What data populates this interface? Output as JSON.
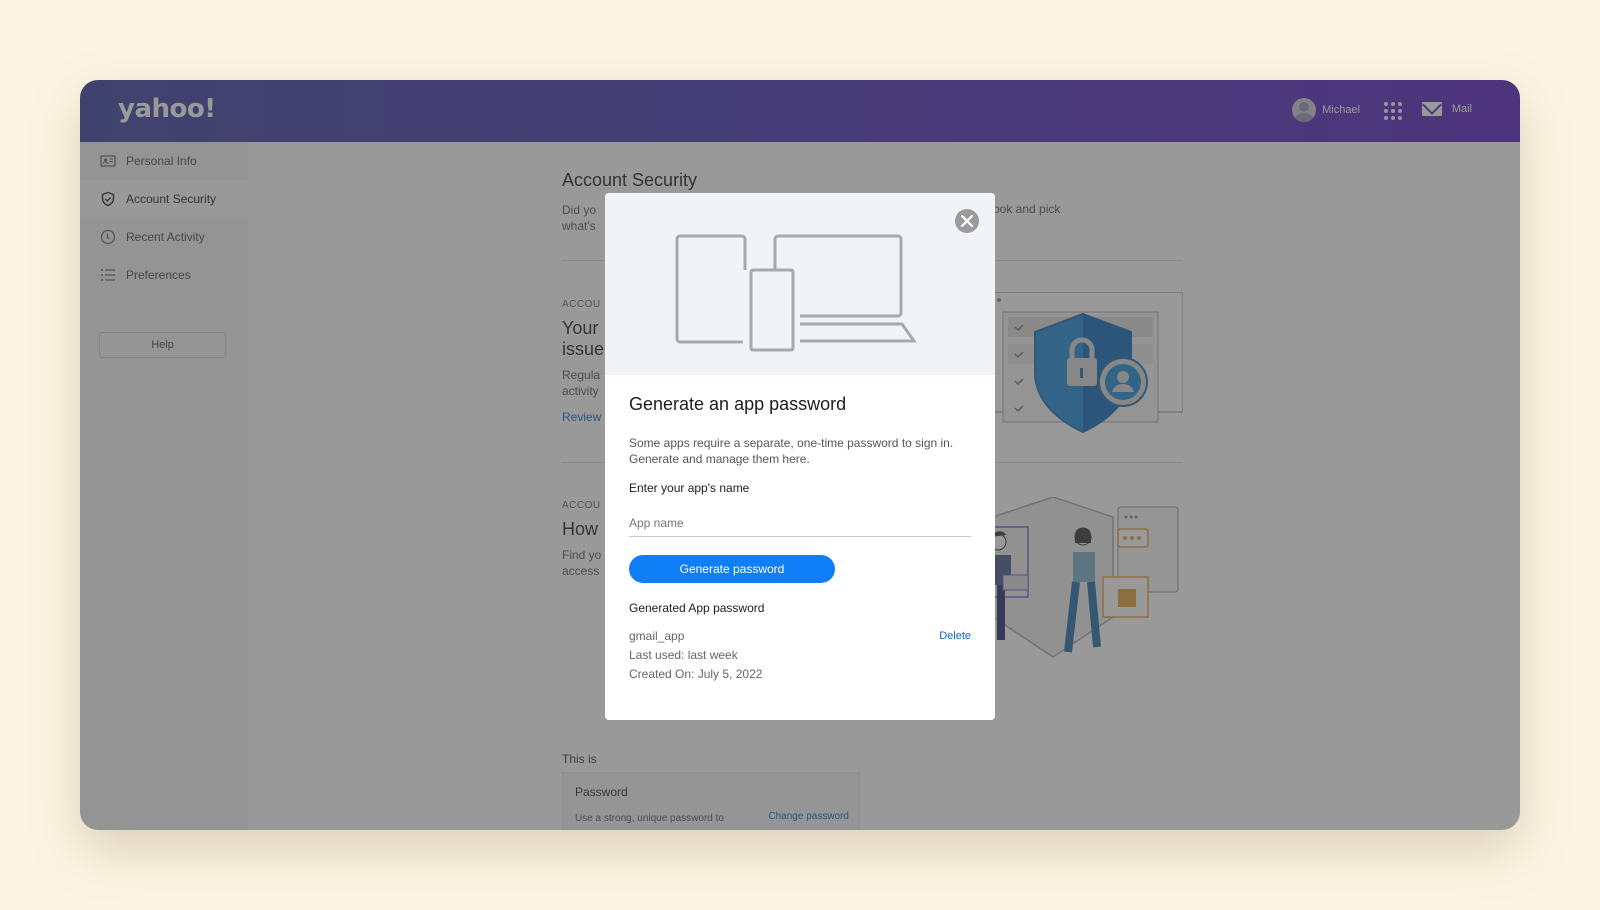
{
  "brand": {
    "logo": "yahoo!"
  },
  "header": {
    "user_name": "Michael",
    "mail_label": "Mail"
  },
  "sidebar": {
    "items": [
      {
        "label": "Personal Info",
        "icon": "id-card-icon",
        "active": false
      },
      {
        "label": "Account Security",
        "icon": "shield-check-icon",
        "active": true
      },
      {
        "label": "Recent Activity",
        "icon": "clock-icon",
        "active": false
      },
      {
        "label": "Preferences",
        "icon": "list-icon",
        "active": false
      }
    ],
    "help_label": "Help"
  },
  "main": {
    "title": "Account Security",
    "intro_left_line1": "Did yo",
    "intro_left_line2": "what's",
    "intro_right": "ook and pick",
    "section1": {
      "label": "ACCOU",
      "title_line1": "Your",
      "title_line2": "issue",
      "text_line1": "Regula",
      "text_line2": "activity",
      "link": "Review"
    },
    "section2": {
      "label": "ACCOU",
      "title": "How",
      "text_line1": "Find yo",
      "text_line2": "access"
    },
    "this_is": "This is",
    "password_card": {
      "title": "Password",
      "description": "Use a strong, unique password to access your account",
      "link": "Change password"
    }
  },
  "modal": {
    "title": "Generate an app password",
    "description": "Some apps require a separate, one-time password to sign in. Generate and manage them here.",
    "field_label": "Enter your app's name",
    "input_placeholder": "App name",
    "input_value": "",
    "generate_button": "Generate password",
    "generated_heading": "Generated App password",
    "entries": [
      {
        "name": "gmail_app",
        "last_used": "Last used: last week",
        "created": "Created On: July 5, 2022",
        "delete_label": "Delete"
      }
    ]
  },
  "colors": {
    "header_gradient_start": "#3b3fa0",
    "header_gradient_end": "#5a20c0",
    "primary_button": "#0f7ef7",
    "link": "#0f69c9",
    "page_background": "#fdf5e4"
  }
}
